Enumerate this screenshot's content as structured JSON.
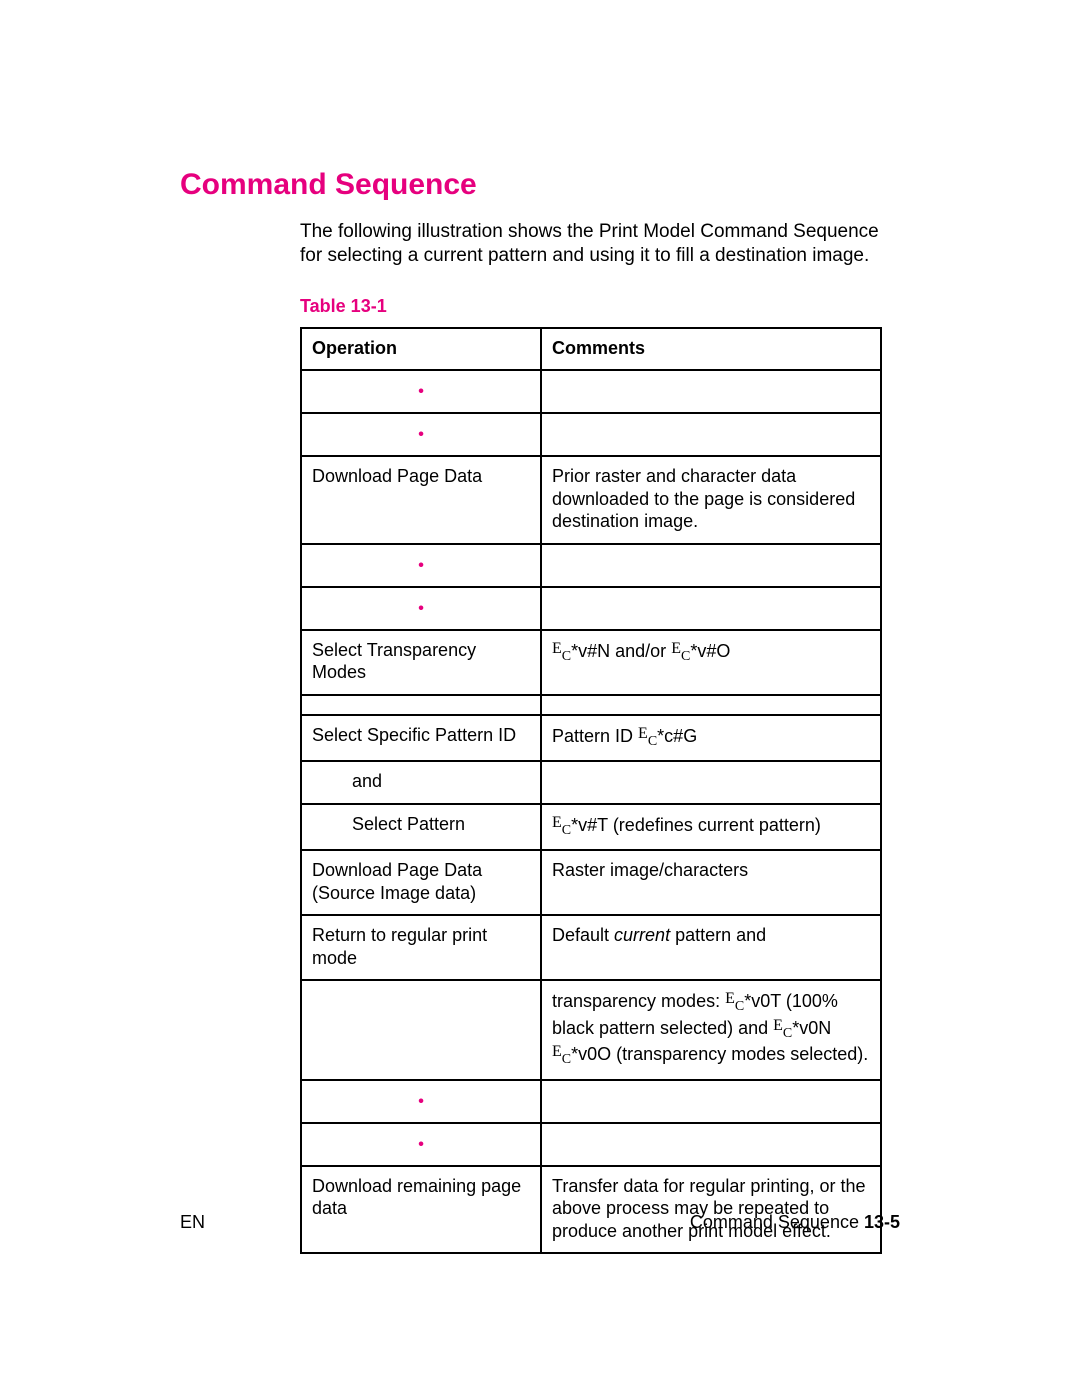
{
  "heading": "Command Sequence",
  "intro": "The following illustration shows the Print Model Command Sequence for selecting a current pattern and using it to fill a destination image.",
  "table_label": "Table 13-1",
  "headers": {
    "operation": "Operation",
    "comments": "Comments"
  },
  "esc": {
    "E": "E",
    "C": "C"
  },
  "rows": {
    "download_page_data": {
      "op": "Download Page Data",
      "cm": "Prior raster and character data downloaded to the page is considered destination image."
    },
    "select_transparency": {
      "op": "Select Transparency Modes",
      "cm_pre": "",
      "code1_tail": "*v#N",
      "andor": " and/or ",
      "code2_tail": "*v#O"
    },
    "select_pattern_id": {
      "op": "Select Specific Pattern ID",
      "cm_prefix": "Pattern ID ",
      "code_tail": "*c#G"
    },
    "and_row": {
      "op": "and"
    },
    "select_pattern": {
      "op": "Select Pattern",
      "code_tail": "*v#T",
      "cm_suffix": " (redefines current pattern)"
    },
    "download_source": {
      "op_line1": "Download Page Data",
      "op_line2": "(Source Image data)",
      "cm": "Raster image/characters"
    },
    "return_regular": {
      "op": "Return to regular print mode",
      "cm_prefix": "Default ",
      "cm_italic": "current",
      "cm_suffix": " pattern and"
    },
    "transparency_detail": {
      "prefix": "transparency modes: ",
      "code1_tail": "*v0T",
      "mid1": " (100% black pattern selected) and ",
      "code2_tail": "*v0N",
      "space": " ",
      "code3_tail": "*v0O",
      "suffix": " (transparency modes selected)."
    },
    "download_remaining": {
      "op": "Download remaining page data",
      "cm": "Transfer data for regular printing, or the above process may be repeated to produce another print model effect."
    }
  },
  "footer": {
    "left": "EN",
    "right_text": "Command Sequence ",
    "right_page": "13-5"
  }
}
